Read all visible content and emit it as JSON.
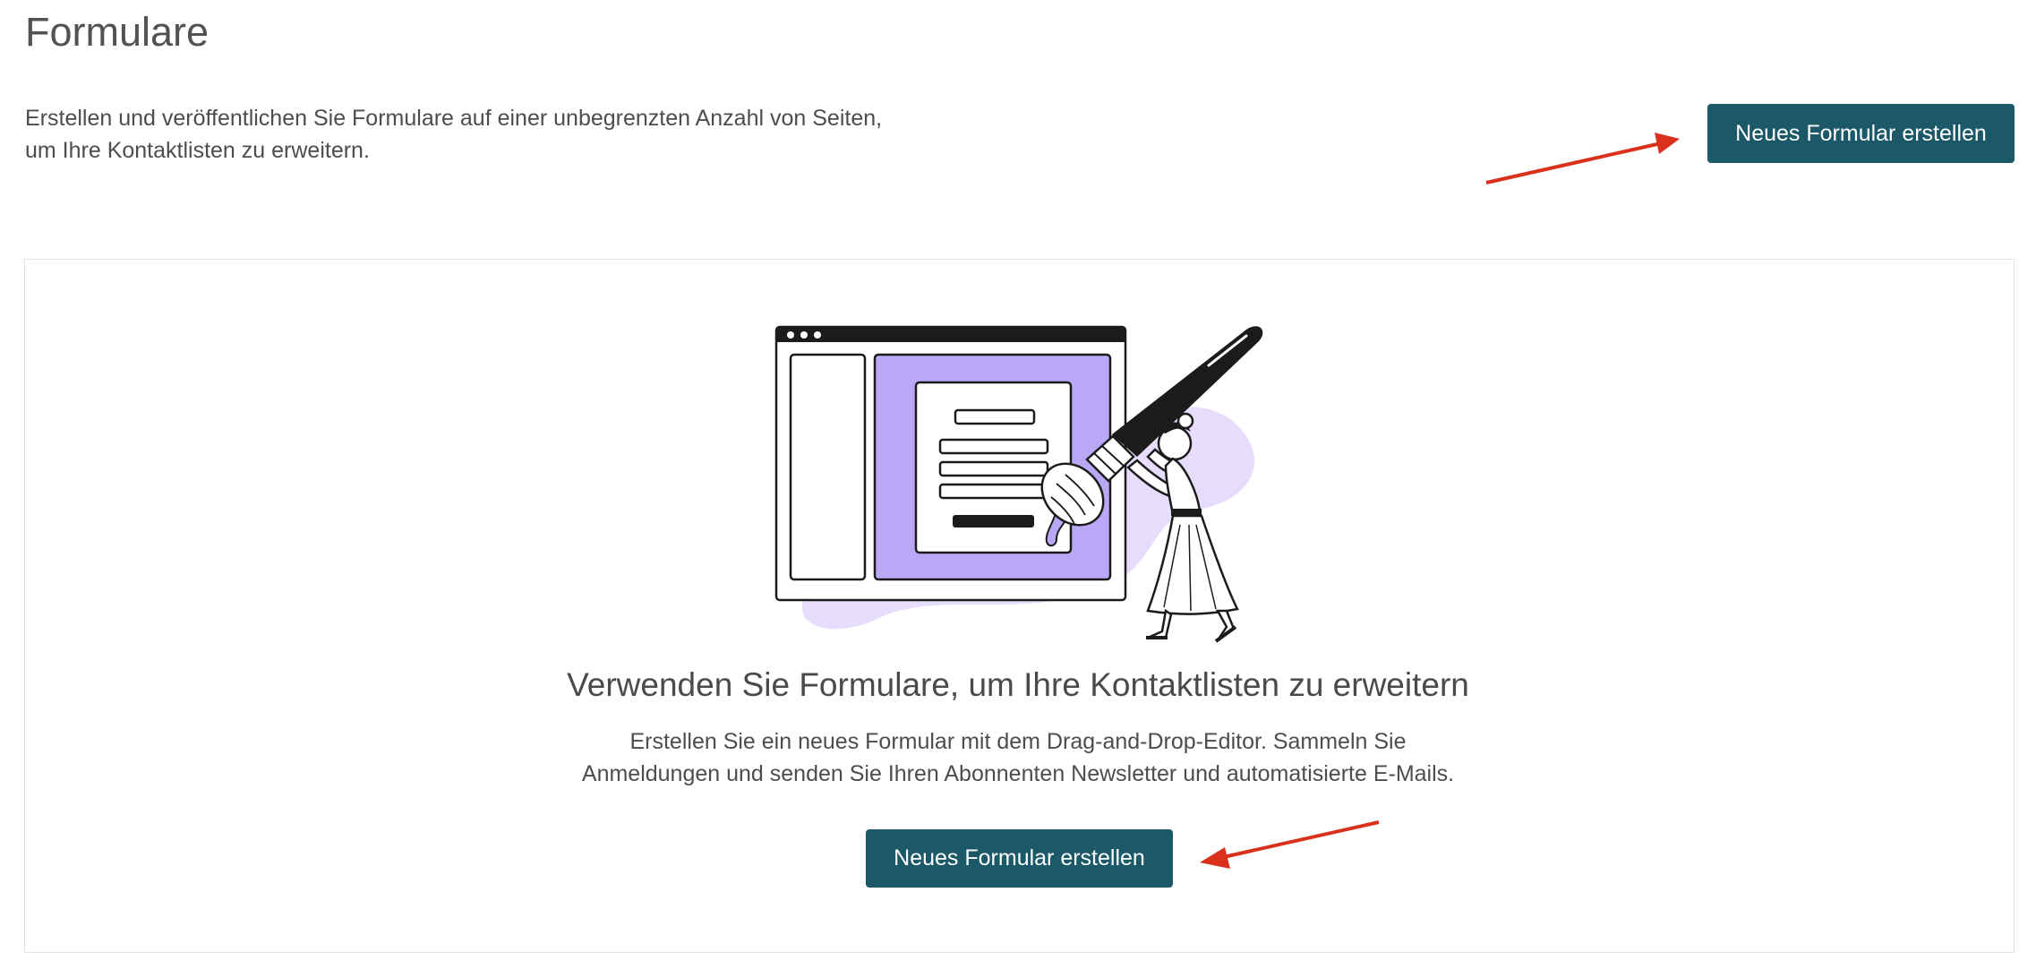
{
  "page": {
    "title": "Formulare",
    "intro_line1": "Erstellen und veröffentlichen Sie Formulare auf einer unbegrenzten Anzahl von Seiten,",
    "intro_line2": "um Ihre Kontaktlisten zu erweitern.",
    "create_button_label": "Neues Formular erstellen"
  },
  "empty_state": {
    "title": "Verwenden Sie Formulare, um Ihre Kontaktlisten zu erweitern",
    "description_line1": "Erstellen Sie ein neues Formular mit dem Drag-and-Drop-Editor. Sammeln Sie",
    "description_line2": "Anmeldungen und senden Sie Ihren Abonnenten Newsletter und automatisierte E-Mails.",
    "create_button_label": "Neues Formular erstellen",
    "illustration_icon": "form-builder-illustration"
  },
  "colors": {
    "accent": "#1b5868",
    "annotation_arrow": "#d9311c",
    "illustration_purple": "#b9a8f5",
    "illustration_blob": "#e6dcfb"
  }
}
